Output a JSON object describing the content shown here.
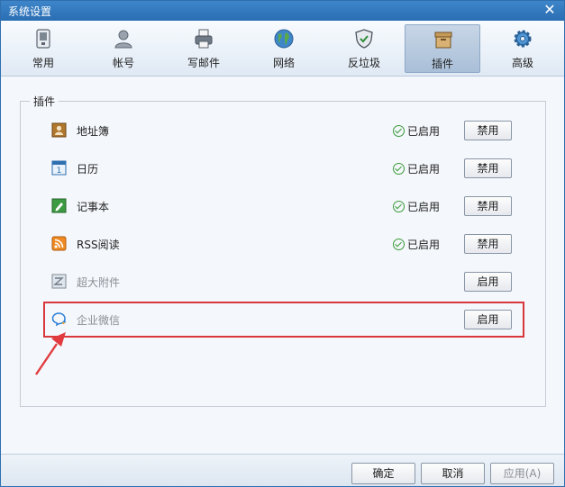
{
  "window": {
    "title": "系统设置"
  },
  "tabs": [
    {
      "label": "常用",
      "icon": "phone-icon",
      "active": false
    },
    {
      "label": "帐号",
      "icon": "user-icon",
      "active": false
    },
    {
      "label": "写邮件",
      "icon": "printer-icon",
      "active": false
    },
    {
      "label": "网络",
      "icon": "globe-icon",
      "active": false
    },
    {
      "label": "反垃圾",
      "icon": "shield-icon",
      "active": false
    },
    {
      "label": "插件",
      "icon": "box-icon",
      "active": true
    },
    {
      "label": "高级",
      "icon": "gear-icon",
      "active": false
    }
  ],
  "plugins_group": {
    "legend": "插件",
    "items": [
      {
        "name": "地址簿",
        "icon": "addressbook-icon",
        "status": "已启用",
        "button": "禁用",
        "enabled": true
      },
      {
        "name": "日历",
        "icon": "calendar-icon",
        "status": "已启用",
        "button": "禁用",
        "enabled": true
      },
      {
        "name": "记事本",
        "icon": "notepad-icon",
        "status": "已启用",
        "button": "禁用",
        "enabled": true
      },
      {
        "name": "RSS阅读",
        "icon": "rss-icon",
        "status": "已启用",
        "button": "禁用",
        "enabled": true
      },
      {
        "name": "超大附件",
        "icon": "attachment-icon",
        "status": "",
        "button": "启用",
        "enabled": false
      },
      {
        "name": "企业微信",
        "icon": "wecom-icon",
        "status": "",
        "button": "启用",
        "enabled": false
      }
    ]
  },
  "footer": {
    "ok": "确定",
    "cancel": "取消",
    "apply": "应用(A)"
  },
  "colors": {
    "accent": "#2a6db3",
    "highlight": "#d8373c",
    "enabled_check": "#3a9a3a"
  }
}
